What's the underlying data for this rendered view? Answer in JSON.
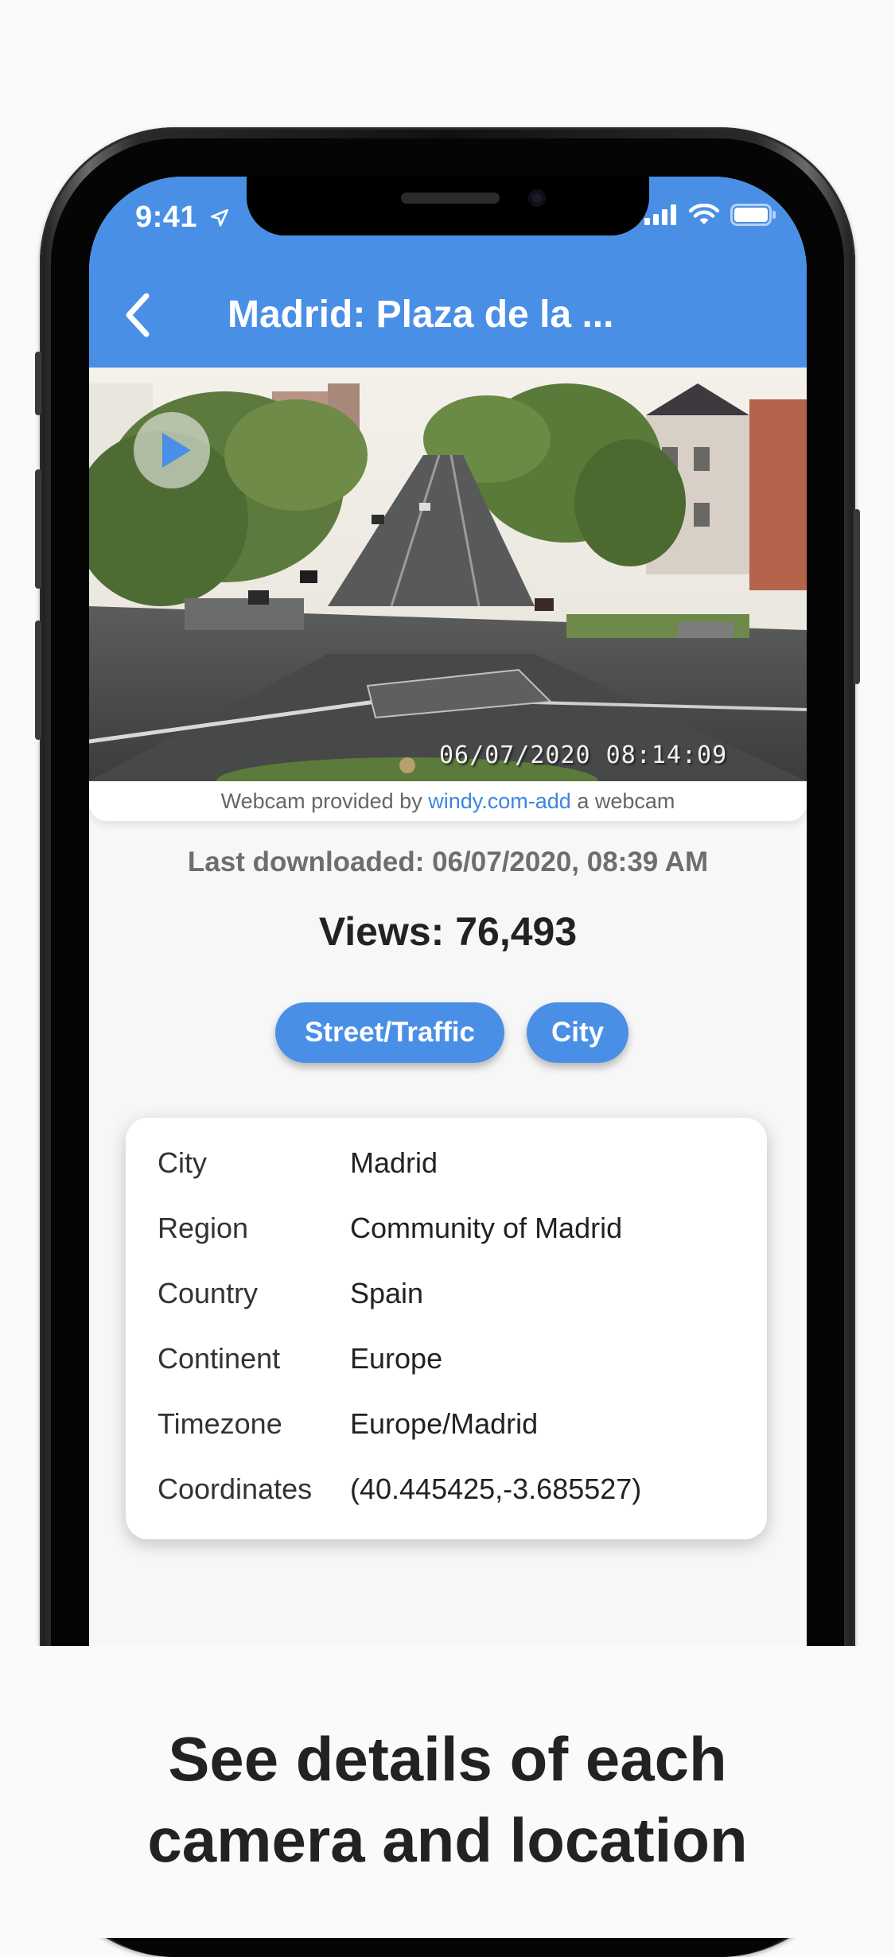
{
  "status_bar": {
    "time": "9:41"
  },
  "nav": {
    "title": "Madrid: Plaza de la ..."
  },
  "webcam": {
    "timestamp": "06/07/2020 08:14:09",
    "credit_prefix": "Webcam provided by",
    "credit_link1": "windy.com",
    "credit_sep": "-",
    "credit_link2": "add",
    "credit_suffix": "a webcam"
  },
  "last_downloaded": "Last downloaded: 06/07/2020, 08:39 AM",
  "views": "Views: 76,493",
  "tags": [
    "Street/Traffic",
    "City"
  ],
  "details": [
    {
      "key": "City",
      "value": "Madrid"
    },
    {
      "key": "Region",
      "value": "Community of Madrid"
    },
    {
      "key": "Country",
      "value": "Spain"
    },
    {
      "key": "Continent",
      "value": "Europe"
    },
    {
      "key": "Timezone",
      "value": "Europe/Madrid"
    },
    {
      "key": "Coordinates",
      "value": "(40.445425,-3.685527)"
    }
  ],
  "caption": {
    "line1": "See details of each",
    "line2": "camera and location"
  },
  "colors": {
    "accent": "#4a8fe6",
    "link": "#3b86e0",
    "background": "#f7f7f7"
  }
}
